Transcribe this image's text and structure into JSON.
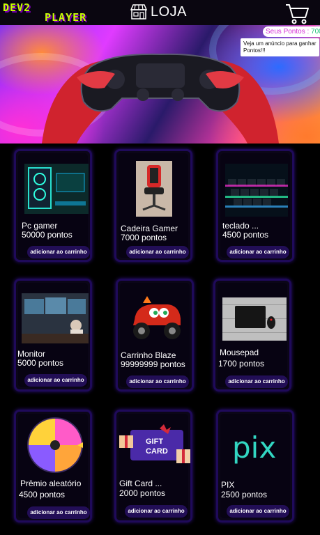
{
  "header": {
    "logo_line1": "DEV2",
    "logo_line2": "PLAYER",
    "store_label": "LOJA"
  },
  "points": {
    "label": "Seus Pontos : ",
    "value": "700"
  },
  "ad": {
    "text": "Veja um anúncio para ganhar Pontos!!!"
  },
  "products": [
    {
      "name": "Pc gamer",
      "price": "50000 pontos",
      "button": "adicionar ao carrinho"
    },
    {
      "name": "Cadeira Gamer",
      "price": "7000 pontos",
      "button": "adicionar ao carrinho"
    },
    {
      "name": "teclado ...",
      "price": "4500 pontos",
      "button": "adicionar ao carrinho"
    },
    {
      "name": "Monitor",
      "price": "5000 pontos",
      "button": "adicionar ao carrinho"
    },
    {
      "name": "Carrinho Blaze",
      "price": "99999999 pontos",
      "button": "adicionar ao carrinho"
    },
    {
      "name": "Mousepad",
      "price": "1700 pontos",
      "button": "adicionar ao carrinho"
    },
    {
      "name": "Prêmio aleatório",
      "price": "4500 pontos",
      "button": "adicionar ao carrinho"
    },
    {
      "name": "Gift Card ...",
      "price": "2000 pontos",
      "button": "adicionar ao carrinho"
    },
    {
      "name": "PIX",
      "price": "2500 pontos",
      "button": "adicionar ao carrinho"
    }
  ],
  "gift_card_text": "GIFT CARD",
  "pix_text": "pix",
  "icons": {
    "store": "store-icon",
    "cart": "shopping-cart-icon"
  },
  "colors": {
    "logo": "#c6ff00",
    "points_label": "#d42bd4",
    "points_value": "#22c07a",
    "card_border": "#1f0a5a",
    "button_bg": "#220e56"
  }
}
